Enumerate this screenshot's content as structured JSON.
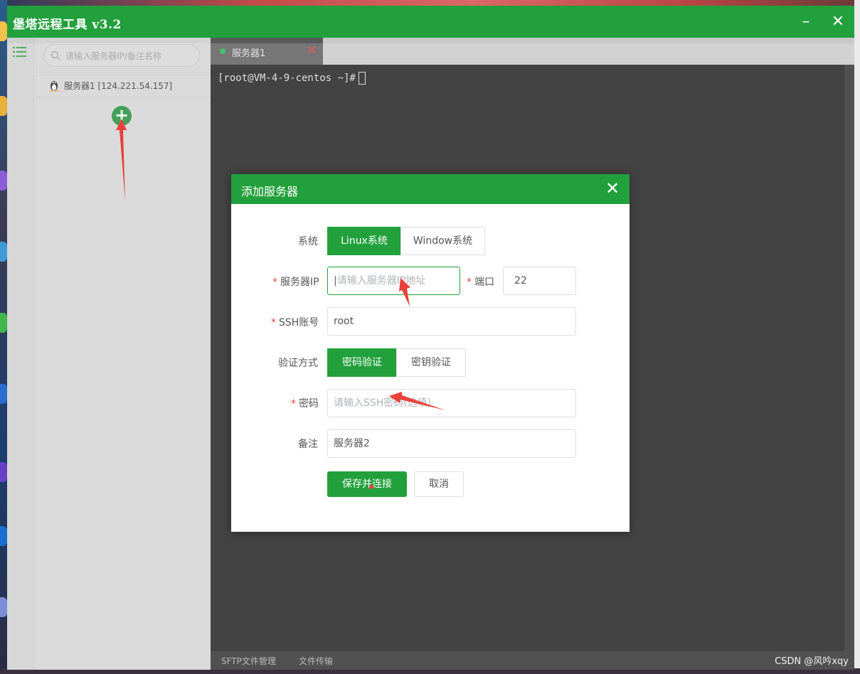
{
  "window": {
    "title": "堡塔远程工具 v3.2"
  },
  "sidebar": {
    "search_placeholder": "请输入服务器IP/备注名称",
    "servers": [
      {
        "label": "服务器1 [124.221.54.157]"
      }
    ]
  },
  "terminal": {
    "tab_label": "服务器1",
    "prompt": "[root@VM-4-9-centos ~]#"
  },
  "bottom_bar": {
    "sftp_label": "SFTP文件管理",
    "transfer_label": "文件传输"
  },
  "dialog": {
    "title": "添加服务器",
    "system_label": "系统",
    "system_options": [
      "Linux系统",
      "Window系统"
    ],
    "system_selected": "Linux系统",
    "ip_label": "服务器IP",
    "ip_placeholder": "请输入服务器IP地址",
    "port_label": "端口",
    "port_value": "22",
    "ssh_label": "SSH账号",
    "ssh_value": "root",
    "auth_label": "验证方式",
    "auth_options": [
      "密码验证",
      "密钥验证"
    ],
    "auth_selected": "密码验证",
    "password_label": "密码",
    "password_placeholder": "请输入SSH密码(选填)",
    "remark_label": "备注",
    "remark_value": "服务器2",
    "save_button": "保存并连接",
    "cancel_button": "取消"
  },
  "watermark": "CSDN @风吟xqy",
  "colors": {
    "accent": "#22a03c",
    "annotation_arrow": "#e8423a"
  }
}
